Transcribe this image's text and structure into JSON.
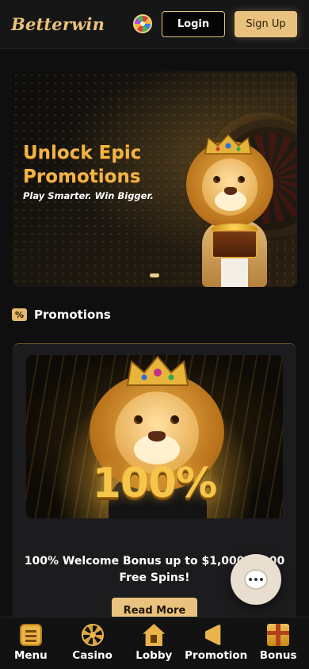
{
  "header": {
    "logo_text": "Betterwin",
    "login_label": "Login",
    "signup_label": "Sign Up"
  },
  "banner": {
    "title": "Unlock Epic Promotions",
    "subtitle": "Play Smarter. Win Bigger.",
    "active_slide": 1
  },
  "promotions": {
    "section_icon": "%",
    "section_title": "Promotions",
    "cards": [
      {
        "image_text": "100%",
        "text": "100% Welcome Bonus up to $1,000 + 100 Free Spins!",
        "button_label": "Read More"
      }
    ]
  },
  "bottom_nav": {
    "items": [
      {
        "label": "Menu",
        "icon": "menu-icon"
      },
      {
        "label": "Casino",
        "icon": "casino-chip-icon"
      },
      {
        "label": "Lobby",
        "icon": "home-icon"
      },
      {
        "label": "Promotion",
        "icon": "megaphone-icon"
      },
      {
        "label": "Bonus",
        "icon": "gift-icon"
      }
    ]
  },
  "colors": {
    "accent_gold": "#e8c27e",
    "banner_title": "#f2b444",
    "background": "#0f0f10"
  }
}
